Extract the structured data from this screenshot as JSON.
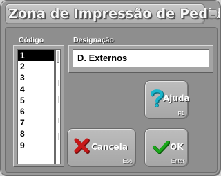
{
  "window": {
    "title": "Zona de Impressão de Pedidos"
  },
  "codigo": {
    "label": "Código",
    "items": [
      "1",
      "2",
      "3",
      "4",
      "5",
      "6",
      "7",
      "8",
      "9"
    ],
    "selected": "1"
  },
  "designacao": {
    "label": "Designação",
    "value": "D. Externos"
  },
  "buttons": {
    "help": {
      "label": "Ajuda",
      "key": "F1",
      "icon": "question-mark-icon"
    },
    "cancel": {
      "label": "Cancela",
      "key": "Esc",
      "icon": "red-x-icon"
    },
    "ok": {
      "label": "OK",
      "key": "Enter",
      "icon": "green-check-icon"
    }
  },
  "colors": {
    "help_icon": "#1ab6cc",
    "cancel_icon": "#c81818",
    "ok_icon": "#1aa81a",
    "selection": "#000000"
  }
}
